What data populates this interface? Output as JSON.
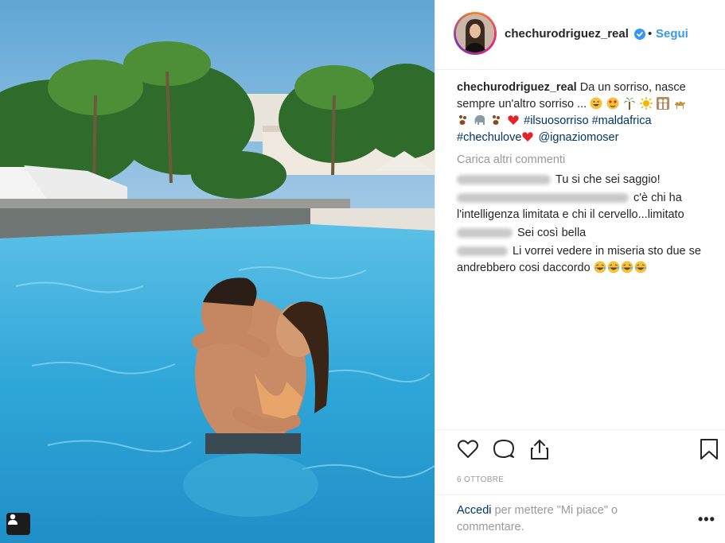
{
  "post": {
    "username": "chechurodriguez_real",
    "dot": "•",
    "follow_label": "Segui",
    "caption_user": "chechurodriguez_real",
    "caption_text": " Da un sorriso, nasce sempre un'altro sorriso ... ",
    "hashtags": [
      "#ilsuosorriso",
      "#maldafrica",
      "#chechulove"
    ],
    "mention": "@ignaziomoser",
    "load_more": "Carica altri commenti",
    "comments": [
      {
        "text": "Tu si che sei saggio!"
      },
      {
        "text": "c'è chi ha l'intelligenza limitata e chi il cervello...limitato"
      },
      {
        "text": "Sei così bella"
      },
      {
        "text": "Li vorrei vedere in miseria sto due se andrebbero cosi daccordo"
      }
    ],
    "date": "6 OTTOBRE",
    "login_link": "Accedi",
    "login_rest": " per mettere \"Mi piace\" o commentare.",
    "more_dots": "•••"
  },
  "colors": {
    "accent_blue": "#3897f0",
    "link_dark": "#003569",
    "muted": "#999999"
  },
  "icons": [
    "verified-badge-icon",
    "heart-icon",
    "comment-icon",
    "share-icon",
    "bookmark-icon",
    "user-tag-icon"
  ]
}
